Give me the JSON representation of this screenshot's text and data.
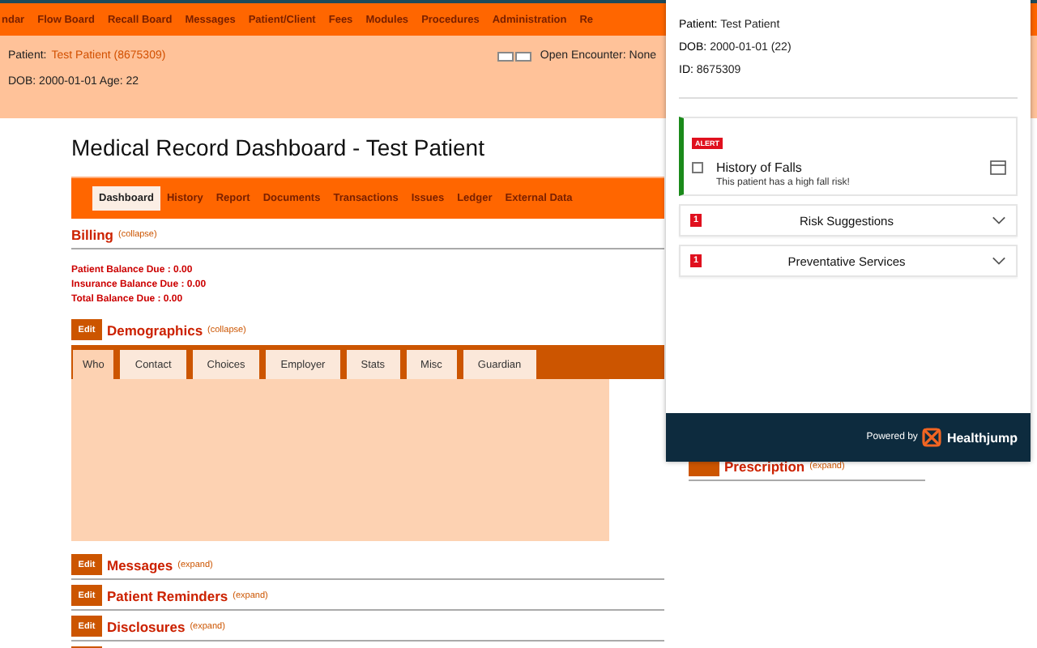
{
  "nav": {
    "items": [
      {
        "label": "ndar"
      },
      {
        "label": "Flow Board"
      },
      {
        "label": "Recall Board"
      },
      {
        "label": "Messages"
      },
      {
        "label": "Patient/Client"
      },
      {
        "label": "Fees"
      },
      {
        "label": "Modules"
      },
      {
        "label": "Procedures"
      },
      {
        "label": "Administration"
      },
      {
        "label": "Re"
      }
    ]
  },
  "patient_header": {
    "patient_label": "Patient:",
    "patient_link": "Test Patient (8675309)",
    "dob_line": "DOB: 2000-01-01 Age: 22",
    "encounter": "Open Encounter: None"
  },
  "title": "Medical Record Dashboard - Test Patient",
  "record_tabs": [
    {
      "label": "Dashboard",
      "selected": true
    },
    {
      "label": "History",
      "selected": false
    },
    {
      "label": "Report",
      "selected": false
    },
    {
      "label": "Documents",
      "selected": false
    },
    {
      "label": "Transactions",
      "selected": false
    },
    {
      "label": "Issues",
      "selected": false
    },
    {
      "label": "Ledger",
      "selected": false
    },
    {
      "label": "External Data",
      "selected": false
    }
  ],
  "billing": {
    "title": "Billing",
    "toggle": "(collapse)",
    "lines": [
      "Patient Balance Due : 0.00",
      "Insurance Balance Due : 0.00",
      "Total Balance Due : 0.00"
    ]
  },
  "demographics": {
    "edit": "Edit",
    "title": "Demographics",
    "toggle": "(collapse)",
    "tabs": [
      {
        "label": "Who",
        "selected": true
      },
      {
        "label": "Contact",
        "selected": false
      },
      {
        "label": "Choices",
        "selected": false
      },
      {
        "label": "Employer",
        "selected": false
      },
      {
        "label": "Stats",
        "selected": false
      },
      {
        "label": "Misc",
        "selected": false
      },
      {
        "label": "Guardian",
        "selected": false
      }
    ]
  },
  "sections": [
    {
      "edit": "Edit",
      "title": "Messages",
      "toggle": "(expand)"
    },
    {
      "edit": "Edit",
      "title": "Patient Reminders",
      "toggle": "(expand)"
    },
    {
      "edit": "Edit",
      "title": "Disclosures",
      "toggle": "(expand)"
    }
  ],
  "right_sections": [
    {
      "title": "Prescription",
      "toggle": "(expand)"
    }
  ],
  "popup": {
    "info": [
      {
        "label": "Patient:",
        "value": "Test Patient"
      },
      {
        "label": "DOB:",
        "value": "2000-01-01 (22)"
      },
      {
        "label": "ID:",
        "value": "8675309"
      }
    ],
    "alert": {
      "badge": "ALERT",
      "title": "History of Falls",
      "description": "This patient has a high fall risk!",
      "checked": false
    },
    "groups": [
      {
        "count": "1",
        "title": "Risk Suggestions",
        "expanded": false
      },
      {
        "count": "1",
        "title": "Preventative Services",
        "expanded": false
      }
    ],
    "footer": {
      "powered": "Powered by",
      "brand": "Healthjump"
    }
  }
}
